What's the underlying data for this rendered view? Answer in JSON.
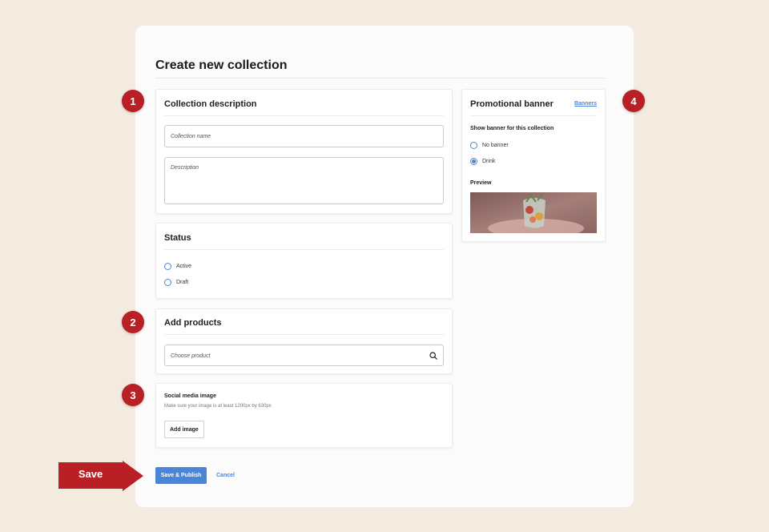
{
  "page": {
    "title": "Create new collection"
  },
  "collection_description": {
    "title": "Collection description",
    "name_placeholder": "Collection name",
    "description_placeholder": "Description"
  },
  "status": {
    "title": "Status",
    "options": [
      {
        "label": "Active",
        "checked": false
      },
      {
        "label": "Draft",
        "checked": false
      }
    ]
  },
  "add_products": {
    "title": "Add products",
    "placeholder": "Choose product",
    "icon": "search-icon"
  },
  "social_media": {
    "title": "Social media image",
    "hint": "Make sure your image is at least 1200px by 630px",
    "button": "Add image"
  },
  "promotional_banner": {
    "title": "Promotional banner",
    "link": "Banners",
    "show_label": "Show banner for this collection",
    "options": [
      {
        "label": "No banner",
        "checked": false
      },
      {
        "label": "Drink",
        "checked": true
      }
    ],
    "preview_label": "Preview"
  },
  "actions": {
    "primary": "Save & Publish",
    "cancel": "Cancel"
  },
  "callouts": {
    "badges": [
      "1",
      "2",
      "3",
      "4"
    ],
    "save_arrow": "Save"
  },
  "colors": {
    "accent": "#4a86d8",
    "badge": "#b82025",
    "background": "#f4ebe0"
  }
}
